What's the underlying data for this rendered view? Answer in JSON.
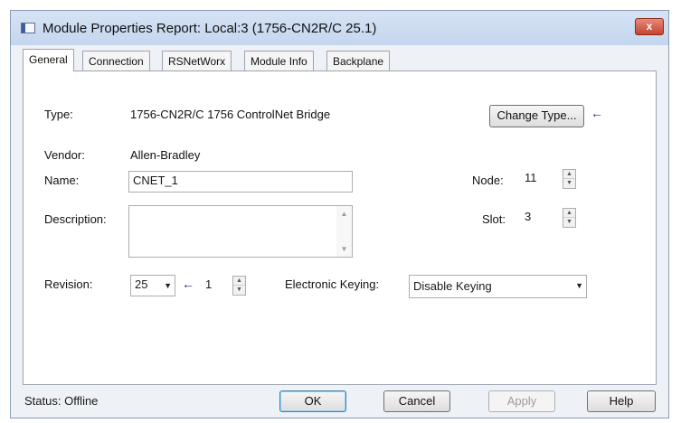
{
  "window": {
    "title": "Module Properties Report: Local:3 (1756-CN2R/C 25.1)",
    "close_label": "x"
  },
  "tabs": [
    {
      "label": "General"
    },
    {
      "label": "Connection"
    },
    {
      "label": "RSNetWorx"
    },
    {
      "label": "Module Info"
    },
    {
      "label": "Backplane"
    }
  ],
  "general": {
    "type_label": "Type:",
    "type_value": "1756-CN2R/C 1756 ControlNet Bridge",
    "change_type_label": "Change Type...",
    "vendor_label": "Vendor:",
    "vendor_value": "Allen-Bradley",
    "name_label": "Name:",
    "name_value": "CNET_1",
    "description_label": "Description:",
    "description_value": "",
    "node_label": "Node:",
    "node_value": "11",
    "slot_label": "Slot:",
    "slot_value": "3",
    "revision_label": "Revision:",
    "revision_major": "25",
    "revision_minor": "1",
    "keying_label": "Electronic Keying:",
    "keying_value": "Disable Keying"
  },
  "footer": {
    "status": "Status:  Offline",
    "ok_label": "OK",
    "cancel_label": "Cancel",
    "apply_label": "Apply",
    "help_label": "Help"
  },
  "icons": {
    "arrow": "←",
    "dropdown": "▼",
    "spin_up": "▲",
    "spin_down": "▼"
  },
  "colors": {
    "titlebar": "#c4d6ee",
    "close": "#c4442e",
    "arrow": "#1b2a8f"
  }
}
